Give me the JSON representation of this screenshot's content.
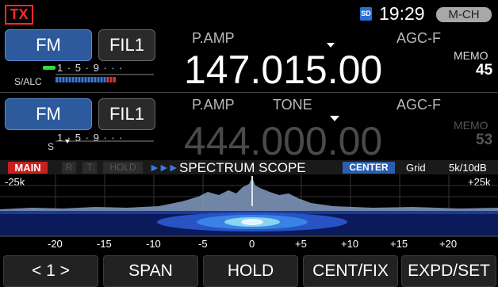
{
  "status": {
    "tx": "TX",
    "sd": "SD",
    "time": "19:29",
    "channel_mode": "M-CH"
  },
  "vfo_main": {
    "mode": "FM",
    "filter": "FIL1",
    "preamp": "P.AMP",
    "agc": "AGC-F",
    "frequency": "147.015.00",
    "memo_label": "MEMO",
    "memo_number": "45",
    "meter_label": "S/ALC",
    "meter_scale": "1 · 5 · 9 · · ·"
  },
  "vfo_sub": {
    "mode": "FM",
    "filter": "FIL1",
    "preamp": "P.AMP",
    "tone": "TONE",
    "agc": "AGC-F",
    "frequency": "444.000.00",
    "memo_label": "MEMO",
    "memo_number": "53",
    "meter_label": "S",
    "meter_scale": "1 · 5 · 9 · · ·"
  },
  "scope": {
    "main_tag": "MAIN",
    "r_tag": "R",
    "t_tag": "T",
    "hold_tag": "HOLD",
    "arrows": "►►►",
    "title": "SPECTRUM SCOPE",
    "center_tag": "CENTER",
    "grid": "Grid",
    "scale": "5k/10dB",
    "left_span": "-25k",
    "right_span": "+25k",
    "freq_ticks": [
      "-20",
      "-15",
      "-10",
      "-5",
      "0",
      "+5",
      "+10",
      "+15",
      "+20"
    ]
  },
  "softkeys": [
    "< 1 >",
    "SPAN",
    "HOLD",
    "CENT/FIX",
    "EXPD/SET"
  ]
}
